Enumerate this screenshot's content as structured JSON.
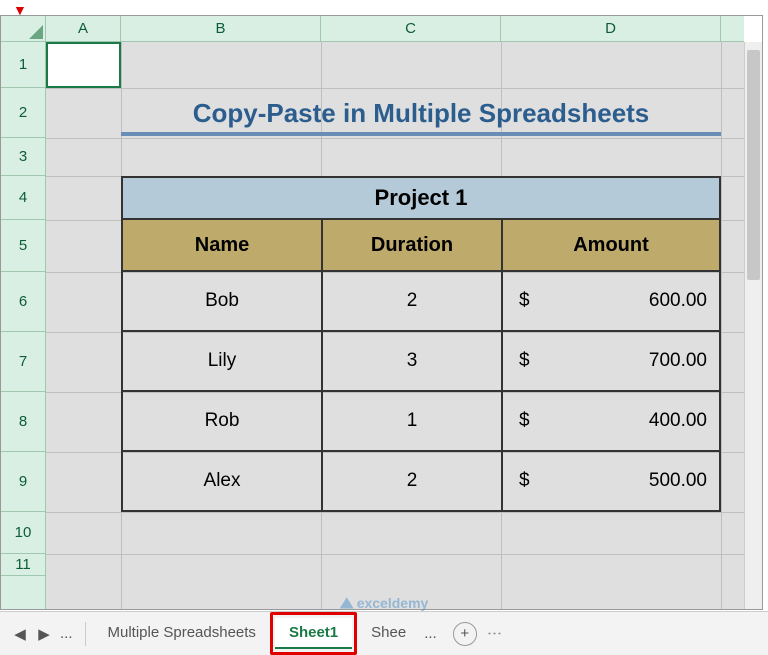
{
  "arrow_glyph": "▼",
  "columns": [
    "A",
    "B",
    "C",
    "D"
  ],
  "rows": [
    "1",
    "2",
    "3",
    "4",
    "5",
    "6",
    "7",
    "8",
    "9",
    "10",
    "11"
  ],
  "title": "Copy-Paste in Multiple Spreadsheets",
  "project_title": "Project 1",
  "headers": {
    "name": "Name",
    "duration": "Duration",
    "amount": "Amount"
  },
  "currency": "$",
  "data_rows": [
    {
      "name": "Bob",
      "duration": "2",
      "amount": "600.00"
    },
    {
      "name": "Lily",
      "duration": "3",
      "amount": "700.00"
    },
    {
      "name": "Rob",
      "duration": "1",
      "amount": "400.00"
    },
    {
      "name": "Alex",
      "duration": "2",
      "amount": "500.00"
    }
  ],
  "tabs": {
    "prev": "◀",
    "next": "▶",
    "ellipsis": "...",
    "items": [
      "Multiple Spreadsheets",
      "Sheet1",
      "Shee"
    ],
    "active": "Sheet1",
    "truncated_ellipsis": "...",
    "add": "+",
    "more": "⋮"
  },
  "watermark": "exceldemy",
  "chart_data": {
    "type": "table",
    "title": "Project 1",
    "columns": [
      "Name",
      "Duration",
      "Amount"
    ],
    "rows": [
      [
        "Bob",
        2,
        600.0
      ],
      [
        "Lily",
        3,
        700.0
      ],
      [
        "Rob",
        1,
        400.0
      ],
      [
        "Alex",
        2,
        500.0
      ]
    ]
  }
}
